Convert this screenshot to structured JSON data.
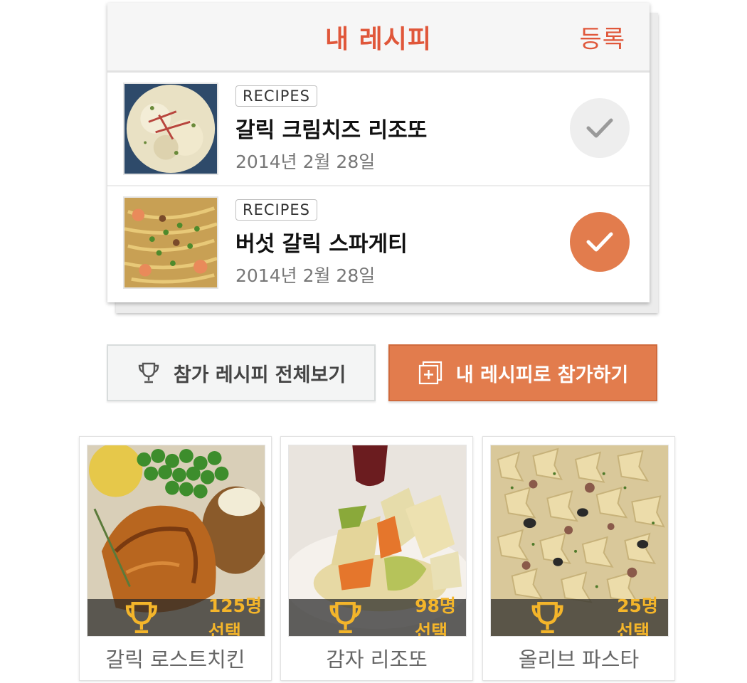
{
  "header": {
    "title": "내 레시피",
    "register_label": "등록"
  },
  "recipes": [
    {
      "tag": "RECIPES",
      "title": "갈릭 크림치즈 리조또",
      "date": "2014년 2월 28일",
      "selected": false
    },
    {
      "tag": "RECIPES",
      "title": "버섯 갈릭 스파게티",
      "date": "2014년 2월 28일",
      "selected": true
    }
  ],
  "buttons": {
    "view_all": "참가 레시피 전체보기",
    "join": "내 레시피로 참가하기"
  },
  "cards": [
    {
      "count": "125명 선택",
      "name": "갈릭 로스트치킨"
    },
    {
      "count": "98명 선택",
      "name": "감자 리조또"
    },
    {
      "count": "25명 선택",
      "name": "올리브 파스타"
    }
  ],
  "colors": {
    "accent": "#e27c4d",
    "title_red": "#e0573a",
    "count_gold": "#f4b52a"
  }
}
